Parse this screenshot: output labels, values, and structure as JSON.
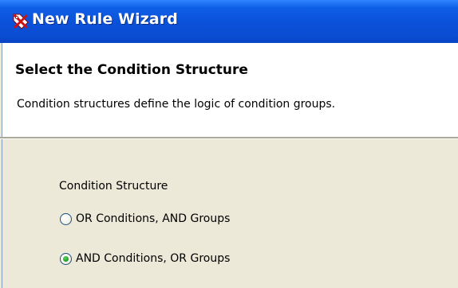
{
  "window": {
    "title": "New Rule Wizard",
    "icon": "rule-wizard-icon",
    "titlebar_color": "#0a50d8"
  },
  "header": {
    "title": "Select the Condition Structure",
    "description": "Condition structures define the logic of condition groups."
  },
  "condition_structure": {
    "label": "Condition Structure",
    "options": [
      {
        "label": "OR Conditions, AND Groups",
        "selected": false
      },
      {
        "label": "AND Conditions, OR Groups",
        "selected": true
      }
    ],
    "radio_selected_color": "#2fa82f"
  }
}
